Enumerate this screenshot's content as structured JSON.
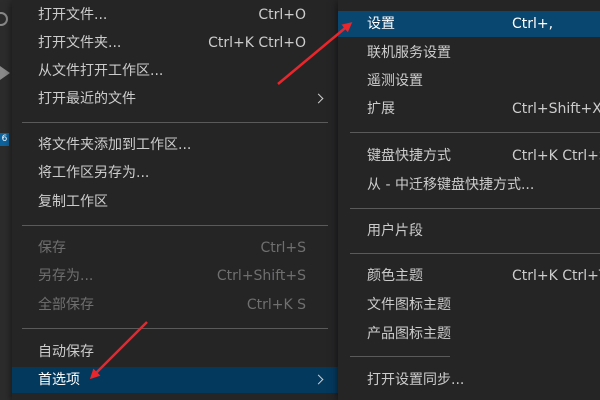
{
  "activity_bar": {
    "badge": "6"
  },
  "file_menu": {
    "items": [
      {
        "label": "打开文件...",
        "shortcut": "Ctrl+O"
      },
      {
        "label": "打开文件夹...",
        "shortcut": "Ctrl+K Ctrl+O"
      },
      {
        "label": "从文件打开工作区..."
      },
      {
        "label": "打开最近的文件"
      },
      {
        "label": "将文件夹添加到工作区..."
      },
      {
        "label": "将工作区另存为..."
      },
      {
        "label": "复制工作区"
      },
      {
        "label": "保存",
        "shortcut": "Ctrl+S"
      },
      {
        "label": "另存为...",
        "shortcut": "Ctrl+Shift+S"
      },
      {
        "label": "全部保存",
        "shortcut": "Ctrl+K S"
      },
      {
        "label": "自动保存"
      },
      {
        "label": "首选项"
      }
    ]
  },
  "preferences_menu": {
    "items": [
      {
        "label": "设置",
        "shortcut": "Ctrl+,"
      },
      {
        "label": "联机服务设置"
      },
      {
        "label": "遥测设置"
      },
      {
        "label": "扩展",
        "shortcut": "Ctrl+Shift+X"
      },
      {
        "label": "键盘快捷方式",
        "shortcut": "Ctrl+K Ctrl+S"
      },
      {
        "label": "从 - 中迁移键盘快捷方式..."
      },
      {
        "label": "用户片段"
      },
      {
        "label": "颜色主题",
        "shortcut": "Ctrl+K Ctrl+T"
      },
      {
        "label": "文件图标主题"
      },
      {
        "label": "产品图标主题"
      },
      {
        "label": "打开设置同步..."
      }
    ]
  },
  "colors": {
    "menu_background": "#252526",
    "selection": "#094771",
    "annotation_arrow": "#e8262b"
  }
}
